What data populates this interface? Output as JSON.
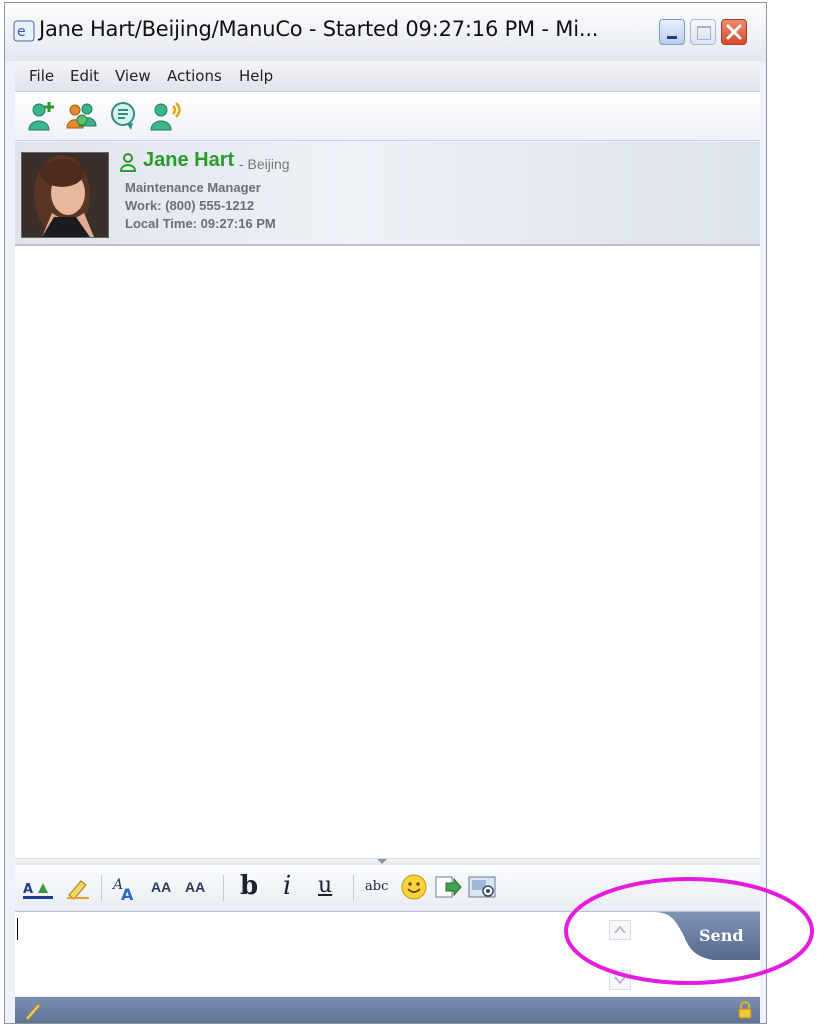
{
  "window": {
    "title": "Jane Hart/Beijing/ManuCo - Started 09:27:16 PM - Mi..."
  },
  "menu": {
    "items": [
      "File",
      "Edit",
      "View",
      "Actions",
      "Help"
    ]
  },
  "toolbar": {
    "icons": [
      "add-person-icon",
      "group-icon",
      "history-icon",
      "call-icon"
    ]
  },
  "contact": {
    "name": "Jane Hart",
    "location": "- Beijing",
    "title": "Maintenance Manager",
    "work_phone": "Work: (800) 555-1212",
    "local_time": "Local Time: 09:27:16 PM",
    "status_color": "#2a9a2a"
  },
  "format_toolbar": {
    "bold_label": "b",
    "italic_label": "i",
    "underline_label": "u",
    "spell_label": "abc",
    "font_grow_label": "AA",
    "font_shrink_label": "AA"
  },
  "composer": {
    "send_label": "Send",
    "value": ""
  },
  "colors": {
    "accent": "#5f749a",
    "highlight": "#e51ce0"
  }
}
